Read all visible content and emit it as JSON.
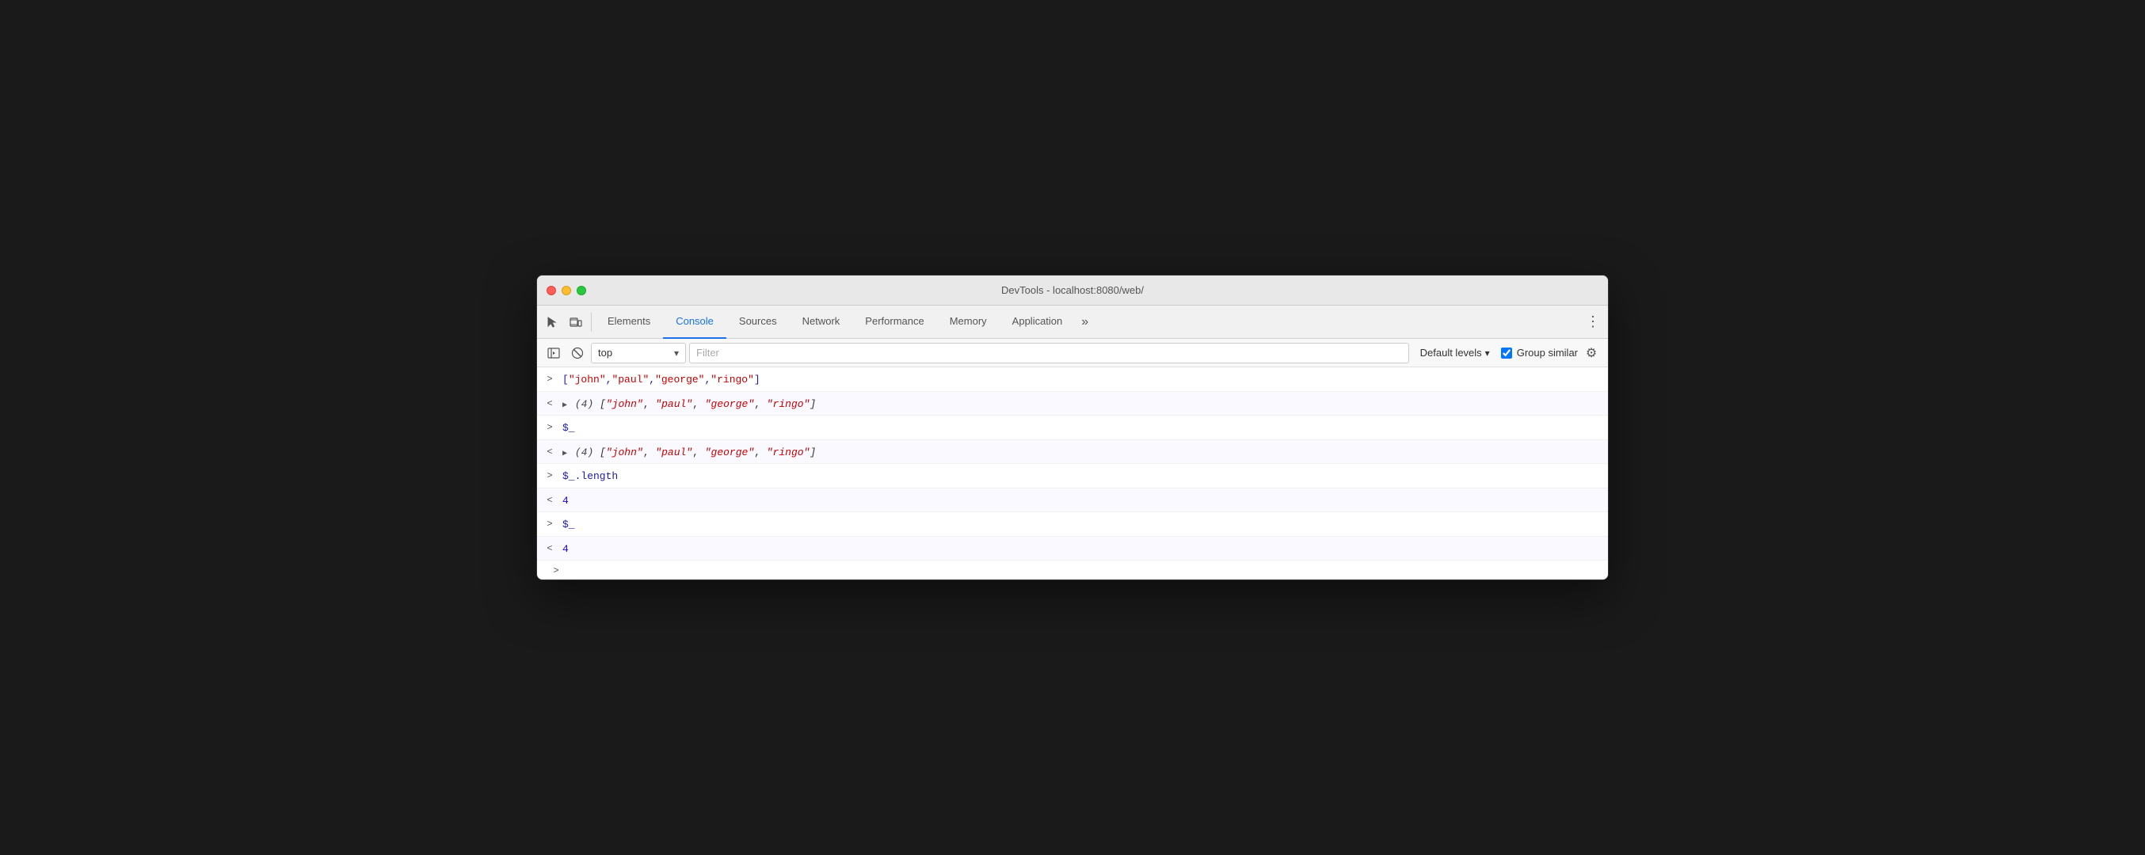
{
  "window": {
    "title": "DevTools - localhost:8080/web/"
  },
  "tabs": [
    {
      "id": "elements",
      "label": "Elements",
      "active": false
    },
    {
      "id": "console",
      "label": "Console",
      "active": true
    },
    {
      "id": "sources",
      "label": "Sources",
      "active": false
    },
    {
      "id": "network",
      "label": "Network",
      "active": false
    },
    {
      "id": "performance",
      "label": "Performance",
      "active": false
    },
    {
      "id": "memory",
      "label": "Memory",
      "active": false
    },
    {
      "id": "application",
      "label": "Application",
      "active": false
    }
  ],
  "console_toolbar": {
    "context": "top",
    "filter_placeholder": "Filter",
    "levels_label": "Default levels",
    "group_similar_label": "Group similar"
  },
  "console_rows": [
    {
      "direction": ">",
      "type": "input",
      "content": "[\"john\",\"paul\",\"george\",\"ringo\"]",
      "expandable": false
    },
    {
      "direction": "<",
      "type": "output",
      "content": "(4) [\"john\", \"paul\", \"george\", \"ringo\"]",
      "expandable": true
    },
    {
      "direction": ">",
      "type": "input",
      "content": "$_",
      "expandable": false
    },
    {
      "direction": "<",
      "type": "output",
      "content": "(4) [\"john\", \"paul\", \"george\", \"ringo\"]",
      "expandable": true
    },
    {
      "direction": ">",
      "type": "input",
      "content": "$_.length",
      "expandable": false
    },
    {
      "direction": "<",
      "type": "output_number",
      "content": "4",
      "expandable": false
    },
    {
      "direction": ">",
      "type": "input",
      "content": "$_",
      "expandable": false
    },
    {
      "direction": "<",
      "type": "output_number",
      "content": "4",
      "expandable": false
    }
  ],
  "icons": {
    "cursor": "⬚",
    "layers": "⬚",
    "more_tabs": "»",
    "kebab": "⋮",
    "expand_console": "▶",
    "clear": "🚫",
    "chevron_down": "▾",
    "gear": "⚙"
  }
}
